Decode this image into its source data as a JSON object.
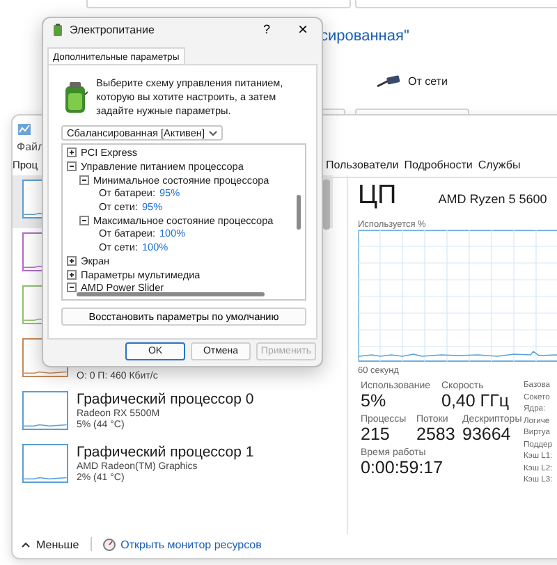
{
  "background_window": {
    "heading_fragment": "сированная\"",
    "power_source": "От сети"
  },
  "task_manager": {
    "menu": [
      "Файл"
    ],
    "tabs": [
      {
        "label": "Проц",
        "selected": false
      },
      {
        "label": "Пользователи",
        "selected": false
      },
      {
        "label": "Подробности",
        "selected": false
      },
      {
        "label": "Службы",
        "selected": false
      }
    ],
    "devices": [
      {
        "color": "#5b9fd6",
        "selected": true
      },
      {
        "color": "#b56ac9",
        "selected": false
      },
      {
        "color": "#8ec46c",
        "selected": false
      },
      {
        "color": "#c98a5a",
        "selected": false,
        "detail": "О: 0 П: 460 Кбит/с"
      },
      {
        "color": "#5b9fd6",
        "selected": false,
        "name": "Графический процессор 0",
        "model": "Radeon RX 5500M",
        "usage": "5% (44 °C)"
      },
      {
        "color": "#5b9fd6",
        "selected": false,
        "name": "Графический процессор 1",
        "model": "AMD Radeon(TM) Graphics",
        "usage": "2% (41 °C)"
      }
    ],
    "cpu": {
      "title": "ЦП",
      "model": "AMD Ryzen 5 5600",
      "graph_label": "Используется %",
      "time_label": "60 секунд",
      "stat_rows": [
        [
          {
            "label": "Использование",
            "value": "5%"
          },
          {
            "label": "Скорость",
            "value": "0,40 ГГц"
          }
        ],
        [
          {
            "label": "Процессы",
            "value": "215"
          },
          {
            "label": "Потоки",
            "value": "2583"
          },
          {
            "label": "Дескрипторы",
            "value": "93664"
          }
        ],
        [
          {
            "label": "Время работы",
            "value": "0:00:59:17"
          }
        ]
      ],
      "specs": [
        "Базова",
        "Сокето",
        "Ядра:",
        "Логиче",
        "Виртуа",
        "Поддер",
        "Кэш L1:",
        "Кэш L2:",
        "Кэш L3:"
      ]
    },
    "footer": {
      "less": "Меньше",
      "link": "Открыть монитор ресурсов"
    }
  },
  "dialog": {
    "title": "Электропитание",
    "help": "?",
    "close": "×",
    "tabs": [
      {
        "label": "Дополнительные параметры",
        "selected": true
      }
    ],
    "intro": "Выберите схему управления питанием, которую вы хотите настроить, а затем задайте нужные параметры.",
    "plan": "Сбалансированная [Активен]",
    "tree": [
      {
        "label": "PCI Express",
        "expanded": false
      },
      {
        "label": "Управление питанием процессора",
        "expanded": true,
        "children": [
          {
            "label": "Минимальное состояние процессора",
            "expanded": true,
            "children": [
              {
                "label": "От батареи:",
                "value": "95%"
              },
              {
                "label": "От сети:",
                "value": "95%"
              }
            ]
          },
          {
            "label": "Максимальное состояние процессора",
            "expanded": true,
            "children": [
              {
                "label": "От батареи:",
                "value": "100%"
              },
              {
                "label": "От сети:",
                "value": "100%"
              }
            ]
          }
        ]
      },
      {
        "label": "Экран",
        "expanded": false
      },
      {
        "label": "Параметры мультимедиа",
        "expanded": false
      },
      {
        "label": "AMD Power Slider",
        "expanded": true
      }
    ],
    "restore": "Восстановить параметры по умолчанию",
    "buttons": [
      {
        "label": "OK",
        "kind": "default",
        "disabled": false
      },
      {
        "label": "Отмена",
        "kind": "normal",
        "disabled": false
      },
      {
        "label": "Применить",
        "kind": "normal",
        "disabled": true
      }
    ]
  }
}
